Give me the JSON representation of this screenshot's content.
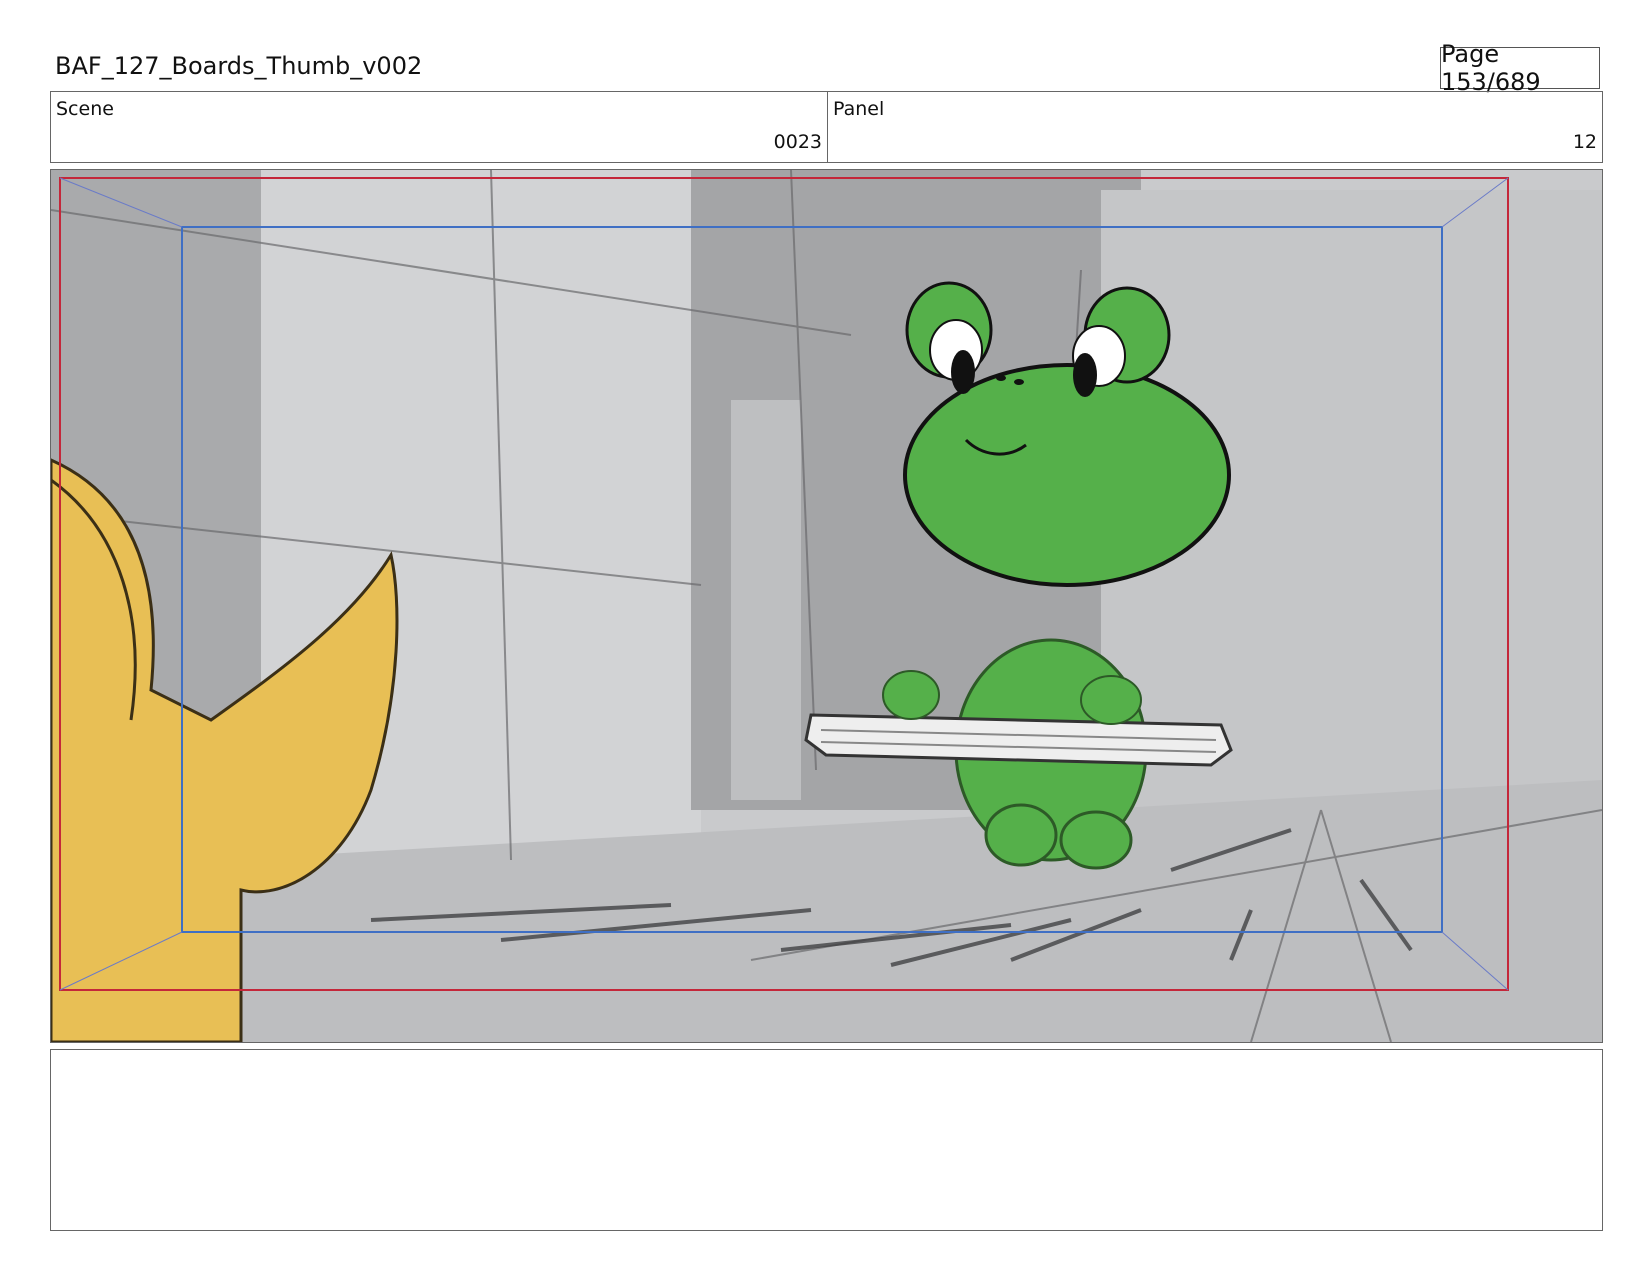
{
  "header": {
    "title": "BAF_127_Boards_Thumb_v002",
    "page_label": "Page 153/689"
  },
  "info": {
    "scene_label": "Scene",
    "scene_value": "0023",
    "panel_label": "Panel",
    "panel_value": "12"
  },
  "panel_image": {
    "subjects": [
      "frog-character",
      "yellow-character",
      "keyboard",
      "hallway-background"
    ],
    "colors": {
      "frog_green": "#55b04a",
      "yellow_character": "#e8bf55",
      "safe_frame": "#3f6fc4",
      "action_frame": "#c4273a",
      "background_gray": "#c8c9cb"
    }
  },
  "notes": {
    "text": ""
  }
}
